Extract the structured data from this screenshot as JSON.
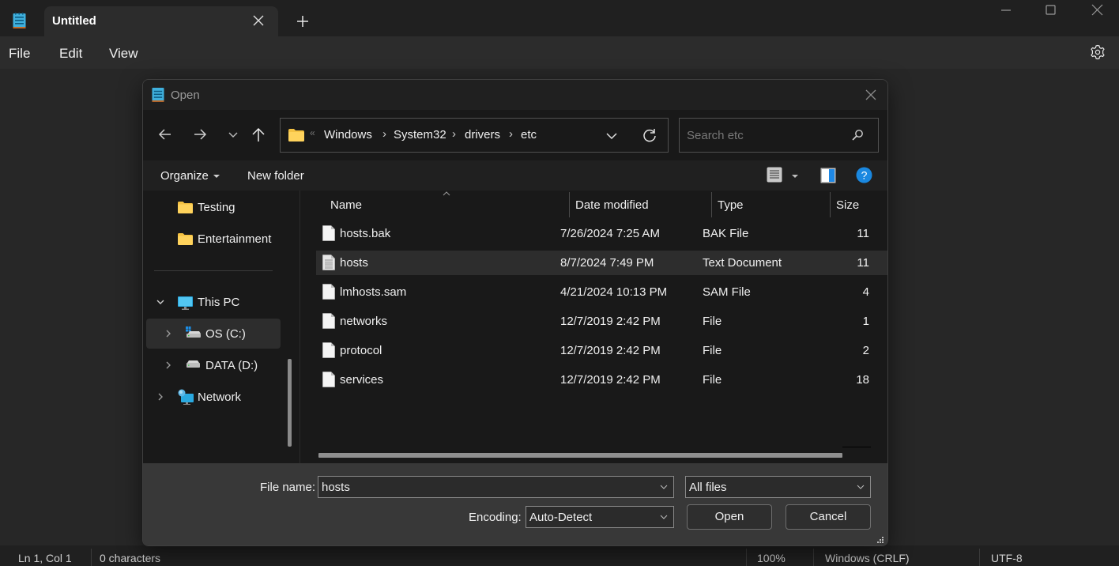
{
  "app": {
    "tab_title": "Untitled",
    "menu": [
      "File",
      "Edit",
      "View"
    ]
  },
  "status": {
    "position": "Ln 1, Col 1",
    "characters": "0 characters",
    "zoom": "100%",
    "line_ending": "Windows (CRLF)",
    "encoding": "UTF-8"
  },
  "dialog": {
    "title": "Open",
    "breadcrumb": [
      "Windows",
      "System32",
      "drivers",
      "etc"
    ],
    "search_placeholder": "Search etc",
    "commands": {
      "organize": "Organize",
      "new_folder": "New folder"
    },
    "sidebar": {
      "folders": [
        {
          "label": "Testing",
          "icon": "folder-icon"
        },
        {
          "label": "Entertainment",
          "icon": "folder-icon"
        }
      ],
      "this_pc": "This PC",
      "drives": [
        {
          "label": "OS (C:)",
          "icon": "os-drive-icon",
          "selected": true
        },
        {
          "label": "DATA (D:)",
          "icon": "drive-icon",
          "selected": false
        }
      ],
      "network": "Network"
    },
    "columns": [
      "Name",
      "Date modified",
      "Type",
      "Size"
    ],
    "files": [
      {
        "name": "hosts.bak",
        "date": "7/26/2024 7:25 AM",
        "type": "BAK File",
        "size": "11",
        "selected": false
      },
      {
        "name": "hosts",
        "date": "8/7/2024 7:49 PM",
        "type": "Text Document",
        "size": "11",
        "selected": true
      },
      {
        "name": "lmhosts.sam",
        "date": "4/21/2024 10:13 PM",
        "type": "SAM File",
        "size": "4",
        "selected": false
      },
      {
        "name": "networks",
        "date": "12/7/2019 2:42 PM",
        "type": "File",
        "size": "1",
        "selected": false
      },
      {
        "name": "protocol",
        "date": "12/7/2019 2:42 PM",
        "type": "File",
        "size": "2",
        "selected": false
      },
      {
        "name": "services",
        "date": "12/7/2019 2:42 PM",
        "type": "File",
        "size": "18",
        "selected": false
      }
    ],
    "file_name_label": "File name:",
    "file_name_value": "hosts",
    "file_type_value": "All files",
    "encoding_label": "Encoding:",
    "encoding_value": "Auto-Detect",
    "open_label": "Open",
    "cancel_label": "Cancel"
  },
  "colors": {
    "accent": "#0078d4",
    "folder": "#ffd35c"
  }
}
